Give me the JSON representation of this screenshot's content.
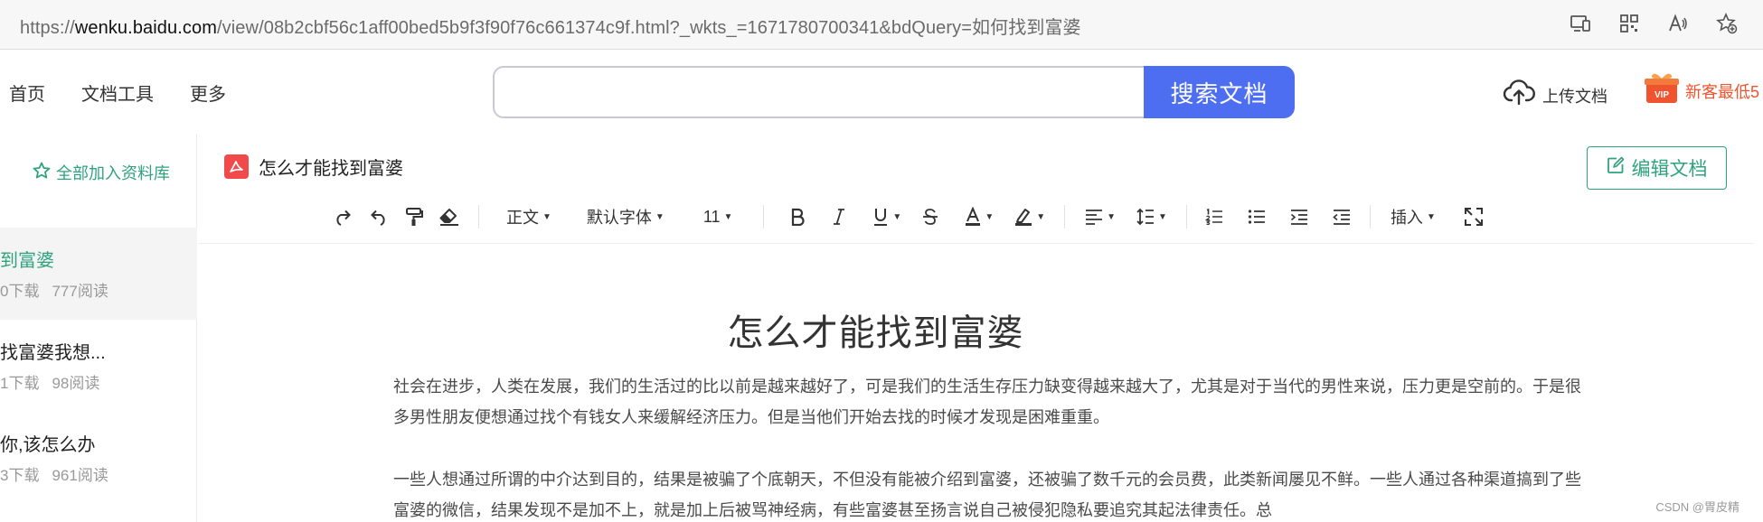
{
  "browser": {
    "url_prefix": "https://",
    "url_host": "wenku.baidu.com",
    "url_path": "/view/08b2cbf56c1aff00bed5b9f3f90f76c661374c9f.html?_wkts_=1671780700341&bdQuery=如何找到富婆",
    "icons": [
      "device-icon",
      "qr-code-icon",
      "read-aloud-icon",
      "favorite-icon"
    ]
  },
  "header": {
    "nav": [
      "首页",
      "文档工具",
      "更多"
    ],
    "search_placeholder": "",
    "search_button": "搜索文档",
    "upload_label": "上传文档",
    "vip_badge": "VIP",
    "vip_label": "新客最低5"
  },
  "sidebar": {
    "add_all_label": "全部加入资料库",
    "items": [
      {
        "title": "到富婆",
        "downloads": "0下载",
        "reads": "777阅读"
      },
      {
        "title": "找富婆我想...",
        "downloads": "1下载",
        "reads": "98阅读"
      },
      {
        "title": "你,该怎么办",
        "downloads": "3下载",
        "reads": "961阅读"
      }
    ]
  },
  "document": {
    "file_name": "怎么才能找到富婆",
    "edit_button": "编辑文档",
    "toolbar": {
      "style": "正文",
      "font": "默认字体",
      "size": "11",
      "insert": "插入"
    },
    "title": "怎么才能找到富婆",
    "paragraphs": [
      "社会在进步，人类在发展，我们的生活过的比以前是越来越好了，可是我们的生活生存压力缺变得越来越大了，尤其是对于当代的男性来说，压力更是空前的。于是很多男性朋友便想通过找个有钱女人来缓解经济压力。但是当他们开始去找的时候才发现是困难重重。",
      "一些人想通过所谓的中介达到目的，结果是被骗了个底朝天，不但没有能被介绍到富婆，还被骗了数千元的会员费，此类新闻屡见不鲜。一些人通过各种渠道搞到了些富婆的微信，结果发现不是加不上，就是加上后被骂神经病，有些富婆甚至扬言说自己被侵犯隐私要追究其起法律责任。总"
    ]
  },
  "watermark": "CSDN @胃皮精",
  "colors": {
    "accent_green": "#2fa37e",
    "search_blue": "#4e6ef2",
    "pdf_red": "#f24a4a",
    "vip_orange": "#f0542f"
  }
}
